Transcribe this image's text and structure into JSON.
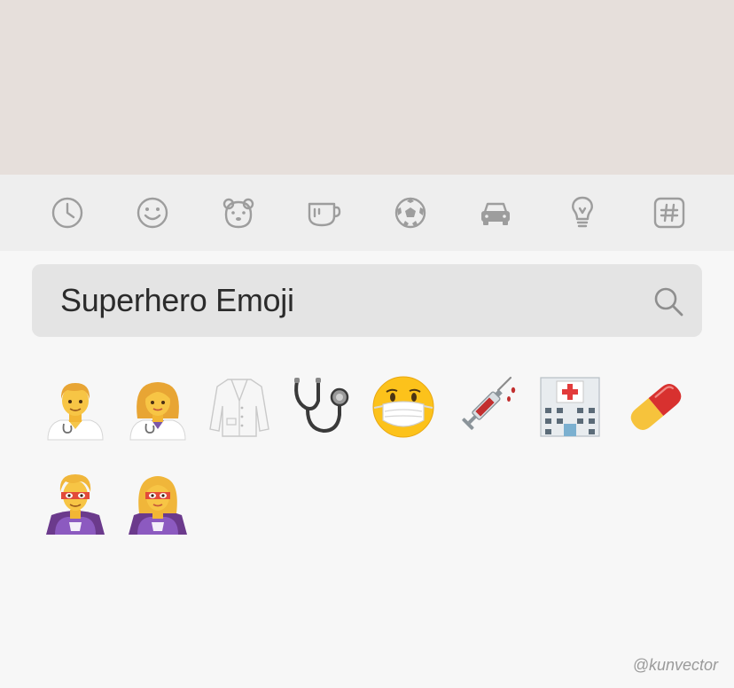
{
  "categories": [
    {
      "icon": "clock-icon"
    },
    {
      "icon": "smiley-icon"
    },
    {
      "icon": "bear-icon"
    },
    {
      "icon": "cup-icon"
    },
    {
      "icon": "soccer-ball-icon"
    },
    {
      "icon": "car-icon"
    },
    {
      "icon": "lightbulb-icon"
    },
    {
      "icon": "hash-symbol-icon"
    }
  ],
  "search": {
    "value": "Superhero Emoji",
    "icon": "search-icon"
  },
  "emojis": [
    {
      "icon": "man-health-worker-emoji"
    },
    {
      "icon": "woman-health-worker-emoji"
    },
    {
      "icon": "lab-coat-emoji"
    },
    {
      "icon": "stethoscope-emoji"
    },
    {
      "icon": "face-with-medical-mask-emoji"
    },
    {
      "icon": "syringe-emoji"
    },
    {
      "icon": "hospital-emoji"
    },
    {
      "icon": "pill-emoji"
    },
    {
      "icon": "man-superhero-emoji"
    },
    {
      "icon": "woman-superhero-emoji"
    }
  ],
  "watermark": "@kunvector",
  "colors": {
    "top_area": "#e6dfdb",
    "category_bar": "#eeeeee",
    "panel": "#f7f7f7",
    "search_field": "#e4e4e4",
    "icon_gray": "#9d9d9d"
  }
}
